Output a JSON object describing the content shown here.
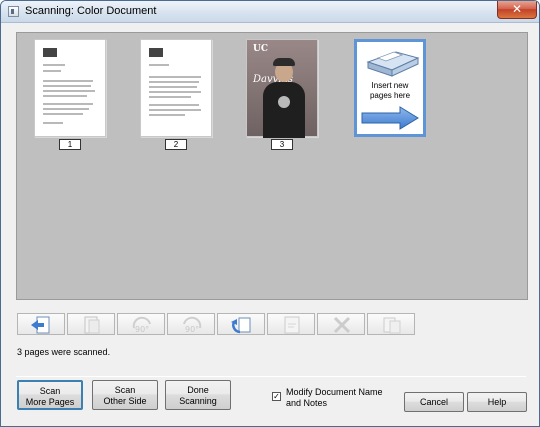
{
  "window": {
    "title": "Scanning: Color Document",
    "close_glyph": "✕"
  },
  "pages": [
    {
      "number": "1",
      "kind": "text-document"
    },
    {
      "number": "2",
      "kind": "text-document"
    },
    {
      "number": "3",
      "kind": "photo-cover",
      "logo_text": "UC",
      "script_text": "Davvins"
    }
  ],
  "insert_tile": {
    "text": "Insert new pages here",
    "icons": [
      "scanner-icon",
      "right-arrow-icon"
    ]
  },
  "toolbar": {
    "buttons": [
      {
        "name": "move-page-left-button",
        "icon": "move-page-icon",
        "enabled": true
      },
      {
        "name": "move-page-right-button",
        "icon": "page-icon",
        "enabled": false
      },
      {
        "name": "rotate-left-90-button",
        "icon": "rotate-90-icon",
        "enabled": false
      },
      {
        "name": "rotate-right-90-button",
        "icon": "rotate-90-icon",
        "enabled": false
      },
      {
        "name": "rotate-180-button",
        "icon": "rotate-icon",
        "enabled": true
      },
      {
        "name": "rescan-page-button",
        "icon": "page-icon",
        "enabled": false
      },
      {
        "name": "delete-page-button",
        "icon": "delete-x-icon",
        "enabled": false
      },
      {
        "name": "page-properties-button",
        "icon": "page-icon",
        "enabled": false
      }
    ],
    "rotate_text": "90°"
  },
  "status": {
    "message": "3 pages were scanned."
  },
  "actions": {
    "scan_more": {
      "line1": "Scan",
      "line2": "More Pages"
    },
    "scan_other": {
      "line1": "Scan",
      "line2": "Other Side"
    },
    "done": {
      "line1": "Done",
      "line2": "Scanning"
    },
    "modify_checkbox": {
      "checked": true,
      "glyph": "✓",
      "line1": "Modify Document Name",
      "line2": "and Notes"
    },
    "cancel_label": "Cancel",
    "help_label": "Help"
  }
}
